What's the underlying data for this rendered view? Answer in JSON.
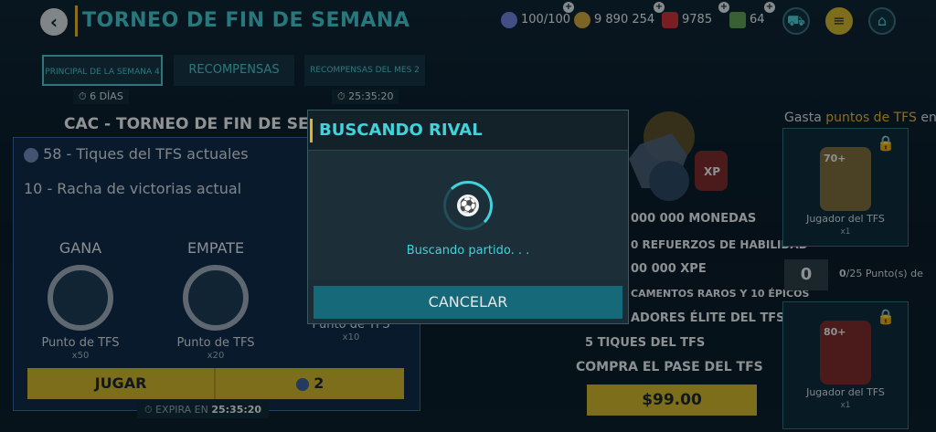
{
  "header": {
    "title": "TORNEO DE FIN DE SEMANA",
    "energy": "100/100",
    "coins": "9 890 254",
    "gems": "9785",
    "cash": "64"
  },
  "tabs": [
    {
      "label": "PRINCIPAL DE LA SEMANA 4",
      "timer": "6 DÍAS"
    },
    {
      "label": "RECOMPENSAS"
    },
    {
      "label": "RECOMPENSAS DEL MES 2",
      "timer": "25:35:20"
    }
  ],
  "left": {
    "heading": "CAC - TORNEO DE FIN DE SE",
    "tickets_line": "58 - Tiques del TFS actuales",
    "streak_line": "10 - Racha de victorias actual",
    "rewards": [
      {
        "title": "GANA",
        "name": "Punto de TFS",
        "qty": "x50"
      },
      {
        "title": "EMPATE",
        "name": "Punto de TFS",
        "qty": "x20"
      },
      {
        "title": "",
        "name": "Punto de TFS",
        "qty": "x10"
      }
    ],
    "play_label": "JUGAR",
    "play_cost": "2",
    "expires_label": "EXPIRA EN",
    "expires_time": "25:35:20"
  },
  "pass": {
    "rewards": [
      "000 000 MONEDAS",
      "0 REFUERZOS DE HABILIDAD",
      "00 000 XPE",
      "CAMENTOS RAROS Y 10 ÉPICOS",
      "ADORES ÉLITE DEL TFS",
      "5 TIQUES DEL TFS"
    ],
    "compra": "COMPRA EL PASE DEL TFS",
    "price": "$99.00"
  },
  "right": {
    "title_prefix": "Gasta",
    "title_highlight": "puntos de TFS",
    "title_suffix": "en",
    "card1_label": "Jugador del TFS",
    "card1_qty": "x1",
    "card1_ovr": "70+",
    "points": "0",
    "points_label": "/25 Punto(s) de",
    "points_value": "0",
    "card2_label": "Jugador del TFS",
    "card2_qty": "x1",
    "card2_ovr": "80+"
  },
  "modal": {
    "title": "BUSCANDO RIVAL",
    "status": "Buscando partido. . .",
    "cancel_label": "CANCELAR"
  },
  "colors": {
    "accent": "#3fd3db",
    "gold": "#c9b22a",
    "bg": "#0a1a26"
  }
}
